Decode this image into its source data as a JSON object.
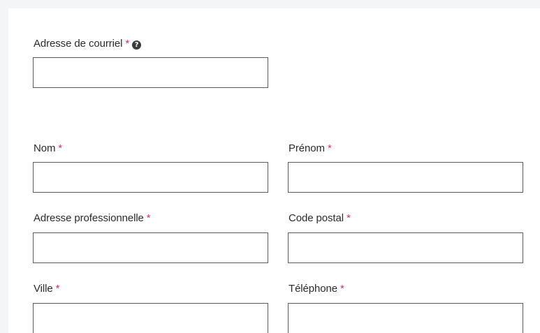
{
  "form": {
    "required_marker": "*",
    "email": {
      "label": "Adresse de courriel",
      "help_icon": "question-circle-icon",
      "value": ""
    },
    "last_name": {
      "label": "Nom",
      "value": ""
    },
    "first_name": {
      "label": "Prénom",
      "value": ""
    },
    "business_address": {
      "label": "Adresse professionnelle",
      "value": ""
    },
    "postal_code": {
      "label": "Code postal",
      "value": ""
    },
    "city": {
      "label": "Ville",
      "value": ""
    },
    "phone": {
      "label": "Téléphone",
      "value": ""
    }
  },
  "colors": {
    "required": "#d6336c",
    "border": "#5a5a5a",
    "panel_background": "#f4f5f7"
  }
}
